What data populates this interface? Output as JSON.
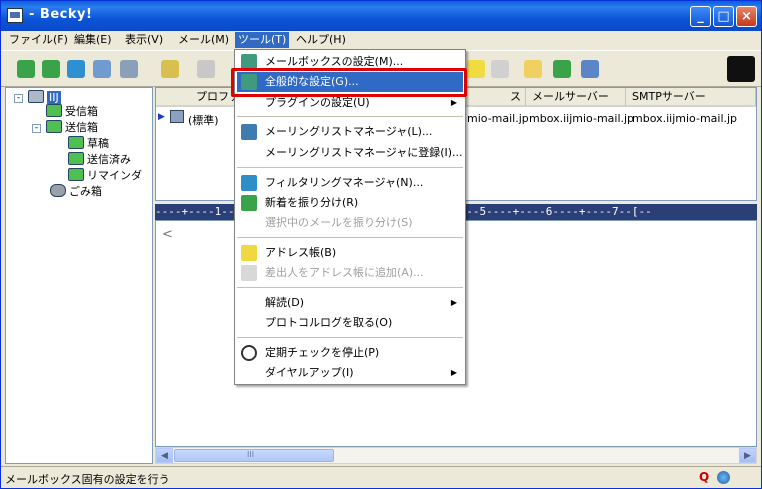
{
  "window": {
    "title": "- Becky!"
  },
  "title_buttons": {
    "minimize": "_",
    "maximize": "□",
    "close": "×"
  },
  "menubar": [
    "ファイル(F)",
    "編集(E)",
    "表示(V)",
    "メール(M)",
    "ツール(T)",
    "ヘルプ(H)"
  ],
  "tree": {
    "root": "IIJ",
    "items": [
      "受信箱",
      "送信箱",
      "草稿",
      "送信済み",
      "リマインダ",
      "ごみ箱"
    ]
  },
  "list": {
    "headers": [
      "プロファ",
      "ス",
      "メールサーバー",
      "SMTPサーバー"
    ],
    "row": {
      "profile": "(標準)",
      "mail_domain": "mio-mail.jp",
      "mail_server": "mbox.iijmio-mail.jp",
      "smtp_server": "mbox.iijmio-mail.jp"
    }
  },
  "ruler": "----+----1----+----2----+----3----+----4----+----5----+----6----+----7--[--",
  "preview": {
    "caret": "<"
  },
  "scroll": {
    "left": "◀",
    "right": "▶",
    "grip": "III"
  },
  "status": {
    "text": "メールボックス固有の設定を行う"
  },
  "tools_menu": {
    "items": [
      {
        "label": "メールボックスの設定(M)...",
        "icon": "mailbox-settings-icon"
      },
      {
        "label": "全般的な設定(G)...",
        "icon": "general-settings-icon",
        "highlighted": true
      },
      {
        "label": "プラグインの設定(U)",
        "submenu": true
      },
      {
        "label": "メーリングリストマネージャ(L)...",
        "icon": "mailing-list-icon"
      },
      {
        "label": "メーリングリストマネージャに登録(I)..."
      },
      {
        "label": "フィルタリングマネージャ(N)...",
        "icon": "filter-icon"
      },
      {
        "label": "新着を振り分け(R)",
        "icon": "sort-new-icon"
      },
      {
        "label": "選択中のメールを振り分け(S)",
        "disabled": true
      },
      {
        "label": "アドレス帳(B)",
        "icon": "address-book-icon"
      },
      {
        "label": "差出人をアドレス帳に追加(A)...",
        "icon": "add-sender-icon",
        "disabled": true
      },
      {
        "label": "解読(D)",
        "submenu": true
      },
      {
        "label": "プロトコルログを取る(O)"
      },
      {
        "label": "定期チェックを停止(P)",
        "icon": "timer-icon"
      },
      {
        "label": "ダイヤルアップ(I)",
        "submenu": true
      }
    ],
    "submenu_arrow": "▶"
  },
  "colors": {
    "selection": "#316ac5",
    "titlebar": "#0a5fd8",
    "highlight_frame": "#e00000"
  }
}
